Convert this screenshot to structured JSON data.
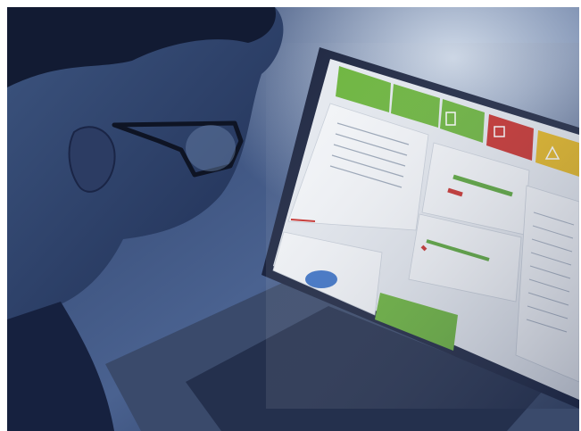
{
  "scene": {
    "description_tags": [
      "person-with-glasses",
      "laptop",
      "monitoring-dashboard"
    ],
    "colors": {
      "background_dark": "#1b2a4e",
      "background_mid": "#3a4f7a",
      "background_light": "#b9c9df",
      "tile_green": "#6bb53b",
      "tile_red": "#c9302c",
      "tile_yellow": "#e6b820",
      "panel": "#e9edf2"
    }
  },
  "dashboard": {
    "tiles": [
      {
        "status": "ok",
        "color": "#6bb53b"
      },
      {
        "status": "ok",
        "color": "#6bb53b"
      },
      {
        "status": "ok",
        "color": "#6bb53b"
      },
      {
        "status": "critical",
        "color": "#c9302c"
      },
      {
        "status": "warning",
        "color": "#e6b820"
      }
    ],
    "bars": [
      {
        "fraction": 0.85,
        "color": "#5aa63a"
      },
      {
        "fraction": 0.2,
        "color": "#c9302c"
      },
      {
        "fraction": 0.75,
        "color": "#5aa63a"
      },
      {
        "fraction": 0.05,
        "color": "#c9302c"
      }
    ]
  }
}
